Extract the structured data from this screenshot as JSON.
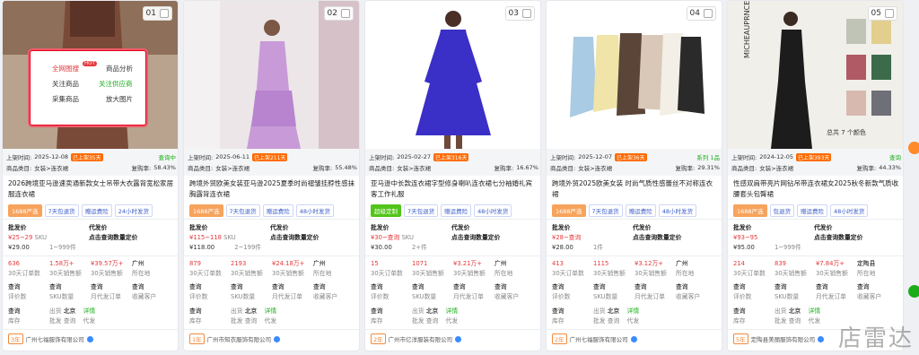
{
  "labels": {
    "listed_prefix": "上架时间:",
    "category_prefix": "商品类目:",
    "wholesale": "批发价",
    "dropship": "代发价",
    "click_query": "点击查询数量定价",
    "sku": "SKU",
    "thirty_day_orders": "30天订单数",
    "thirty_day_sales": "30天销售额",
    "query": "查询",
    "reviews": "评价数",
    "sku_count": "SKU数量",
    "monthly_dropship": "月代发订单",
    "fav_customers": "收藏客户",
    "stock": "库存",
    "wholesale_short": "批发",
    "dropship_short": "代发",
    "detail": "详情",
    "origin_placeholder": "出货",
    "beijing": "北京",
    "repurchase_prefix": "复购率:"
  },
  "popup": {
    "all_net": "全网图搜",
    "hot": "HOT",
    "analysis": "商品分析",
    "follow": "关注商品",
    "follow_supplier": "关注供应商",
    "collect": "采集商品",
    "zoom": "放大图片"
  },
  "cards": [
    {
      "index": "01",
      "date": "2025-12-08",
      "tag": "已上架35天",
      "right_top": "查询中",
      "category": "女装>连衣裙",
      "repurchase": "58.43%",
      "title": "2026跨境亚马逊速卖通新款女士吊带大衣露背宽松家居服连衣裙",
      "badges": [
        "1688严选",
        "7天包退货",
        "赠运费险",
        "24小时发货"
      ],
      "price_range": "¥25~29",
      "unit": "SKU",
      "price": "¥29.00",
      "moq": "1~999件",
      "orders": "636",
      "sales_raw": "1.58万+",
      "revenue": "¥39.57万+",
      "city": "广州",
      "city_sub": "所在地",
      "loc": "北京",
      "supplier_years": "3年",
      "supplier": "广州七福服饰有限公司"
    },
    {
      "index": "02",
      "date": "2025-06-11",
      "tag": "已上架211天",
      "right_top": "",
      "category": "女装>连衣裙",
      "repurchase": "55.48%",
      "title": "跨境外贸欧美女装亚马逊2025夏季时尚褶皱挂脖性感抹胸露背连衣裙",
      "badges": [
        "1688严选",
        "7天包退货",
        "赠运费险",
        "48小时发货"
      ],
      "price_range": "¥115~118",
      "unit": "SKU",
      "price": "¥118.00",
      "moq": "2~199件",
      "orders": "879",
      "sales_raw": "2193",
      "revenue": "¥24.18万+",
      "city": "广州",
      "city_sub": "所在地",
      "loc": "北京",
      "supplier_years": "1年",
      "supplier": "广州市知衣服饰有限公司"
    },
    {
      "index": "03",
      "date": "2025-02-27",
      "tag": "已上架316天",
      "right_top": "",
      "category": "女装>连衣裙",
      "repurchase": "16.67%",
      "title": "亚马逊中长款连衣裙字型修身喇叭连衣裙七分袖婚礼宾客工作礼服",
      "badges": [
        "超级定制",
        "7天包退货",
        "赠运费险",
        "48小时发货"
      ],
      "price_range": "¥30~查询",
      "unit": "SKU",
      "price": "¥30.00",
      "moq": "2+件",
      "orders": "15",
      "sales_raw": "1071",
      "revenue": "¥3.21万+",
      "city": "广州",
      "city_sub": "所在地",
      "loc": "北京",
      "supplier_years": "2年",
      "supplier": "广州市亿洋服装有限公司"
    },
    {
      "index": "04",
      "date": "2025-12-07",
      "tag": "已上架36天",
      "right_top": "系列 1品",
      "category": "女装>连衣裙",
      "repurchase": "29.31%",
      "title": "跨境外贸2025欧美女装 时尚气质性感蕾丝不对称连衣裙",
      "badges": [
        "1688严选",
        "7天包退货",
        "赠运费险",
        "48小时发货"
      ],
      "price_range": "¥28~查询",
      "unit": "",
      "price": "¥28.00",
      "moq": "1件",
      "orders": "413",
      "sales_raw": "1115",
      "revenue": "¥3.12万+",
      "city": "广州",
      "city_sub": "所在地",
      "loc": "北京",
      "supplier_years": "2年",
      "supplier": "广州七福服饰有限公司"
    },
    {
      "index": "05",
      "date": "2024-12-05",
      "tag": "已上架393天",
      "right_top": "查询",
      "category": "女装>连衣裙",
      "repurchase": "44.33%",
      "title": "性感双肩带亮片网钻吊带连衣裙女2025秋冬新款气质收腰套头包臀裙",
      "badges": [
        "1688严选",
        "包退货",
        "赠运费险",
        "48小时发货"
      ],
      "price_range": "¥93~95",
      "unit": "",
      "price": "¥95.00",
      "moq": "1~999件",
      "orders": "214",
      "sales_raw": "839",
      "revenue": "¥7.84万+",
      "city": "定陶县",
      "city_sub": "所在地",
      "loc": "北京",
      "supplier_years": "5年",
      "supplier": "定陶县美丽服饰有限公司",
      "image_caption": "总共 7 个颜色"
    }
  ],
  "watermark": "店雷达"
}
